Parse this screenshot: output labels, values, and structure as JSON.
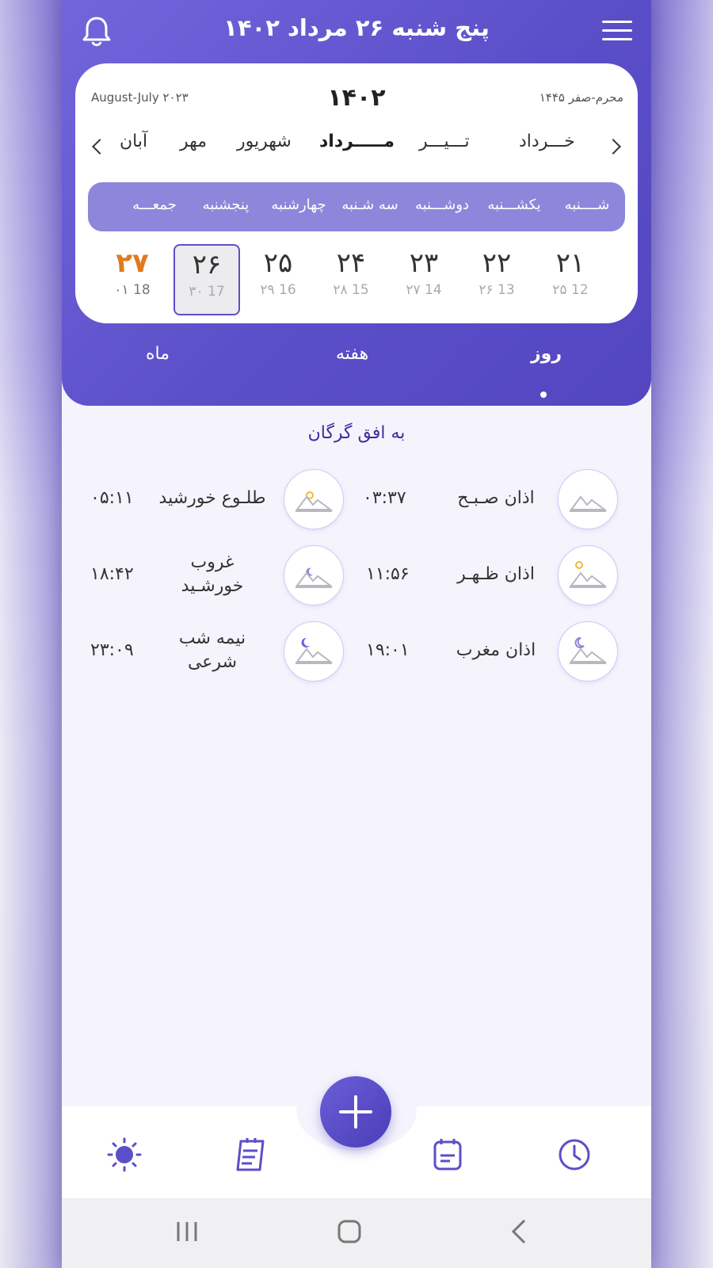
{
  "header": {
    "title": "پنج شنبه ۲۶ مرداد ۱۴۰۲"
  },
  "calendar": {
    "gregorian": "August-July ۲۰۲۳",
    "year": "۱۴۰۲",
    "hijri": "محرم-صفر ۱۴۴۵",
    "months": [
      "خـــرداد",
      "تـــیـــر",
      "مـــــرداد",
      "شهریور",
      "مهر",
      "آبان"
    ],
    "active_month": "مـــــرداد",
    "weekdays": [
      "شــــنبه",
      "یکشـــنبه",
      "دوشـــنبه",
      "سه شـنبه",
      "چهارشنبه",
      "پنجشنبه",
      "جمعـــه"
    ],
    "days": [
      {
        "persian": "۲۱",
        "sub": "۲۵ 12"
      },
      {
        "persian": "۲۲",
        "sub": "۲۶ 13"
      },
      {
        "persian": "۲۳",
        "sub": "۲۷ 14"
      },
      {
        "persian": "۲۴",
        "sub": "۲۸ 15"
      },
      {
        "persian": "۲۵",
        "sub": "۲۹ 16"
      },
      {
        "persian": "۲۶",
        "sub": "۳۰ 17",
        "selected": true
      },
      {
        "persian": "۲۷",
        "sub": "۰۱ 18",
        "holiday": true
      }
    ]
  },
  "tabs": [
    "روز",
    "هفته",
    "ماه"
  ],
  "active_tab": "روز",
  "horizon": "به افق گرگان",
  "prayers": [
    {
      "name": "اذان صـبـح",
      "time": "۰۳:۳۷",
      "icon": "mountain-icon"
    },
    {
      "name": "طلـوع خورشید",
      "time": "۰۵:۱۱",
      "icon": "sunrise-icon"
    },
    {
      "name": "اذان ظـهـر",
      "time": "۱۱:۵۶",
      "icon": "sun-icon"
    },
    {
      "name": "غروب خورشـید",
      "time": "۱۸:۴۲",
      "icon": "sunset-icon"
    },
    {
      "name": "اذان مغرب",
      "time": "۱۹:۰۱",
      "icon": "moon-icon"
    },
    {
      "name": "نیمه شب شرعی",
      "time": "۲۳:۰۹",
      "icon": "midnight-icon"
    }
  ],
  "colors": {
    "primary": "#5b4fc9",
    "weekday_bar": "#8e86db",
    "holiday": "#e07a1f",
    "sun": "#f3b63b"
  }
}
